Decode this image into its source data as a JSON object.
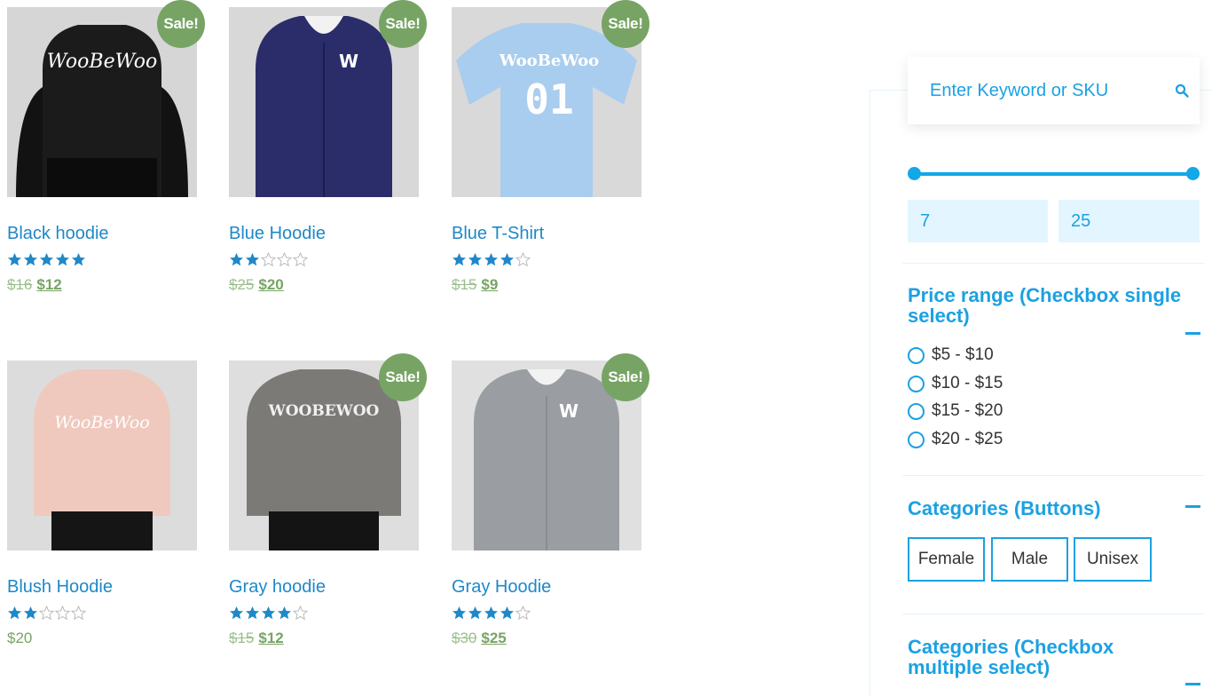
{
  "products": [
    {
      "title": "Black hoodie",
      "sale": "Sale!",
      "rating": 5,
      "old_price": "$16",
      "price": "$12",
      "art": "black-hoodie"
    },
    {
      "title": "Blue Hoodie",
      "sale": "Sale!",
      "rating": 2,
      "old_price": "$25",
      "price": "$20",
      "art": "blue-hoodie"
    },
    {
      "title": "Blue T-Shirt",
      "sale": "Sale!",
      "rating": 4,
      "old_price": "$15",
      "price": "$9",
      "art": "blue-tshirt"
    },
    {
      "title": "Blush Hoodie",
      "sale": "",
      "rating": 2,
      "old_price": "",
      "price": "$20",
      "art": "blush-hoodie"
    },
    {
      "title": "Gray hoodie",
      "sale": "Sale!",
      "rating": 4,
      "old_price": "$15",
      "price": "$12",
      "art": "gray-hoodie"
    },
    {
      "title": "Gray Hoodie",
      "sale": "Sale!",
      "rating": 4,
      "old_price": "$30",
      "price": "$25",
      "art": "gray-zip-hoodie"
    }
  ],
  "sidebar": {
    "search": {
      "placeholder": "Enter Keyword or SKU",
      "icon": "search-icon"
    },
    "price_slider": {
      "min": "7",
      "max": "25"
    },
    "price_range": {
      "title": "Price range (Checkbox single select)",
      "options": [
        "$5 - $10",
        "$10 - $15",
        "$15 - $20",
        "$20 - $25"
      ]
    },
    "categories_buttons": {
      "title": "Categories (Buttons)",
      "buttons": [
        "Female",
        "Male",
        "Unisex"
      ]
    },
    "categories_multi": {
      "title": "Categories (Checkbox multiple select)"
    }
  },
  "colors": {
    "accent": "#1ba1e2",
    "link": "#1e88c8",
    "sale": "#77a464",
    "star": "#1e88c8"
  }
}
